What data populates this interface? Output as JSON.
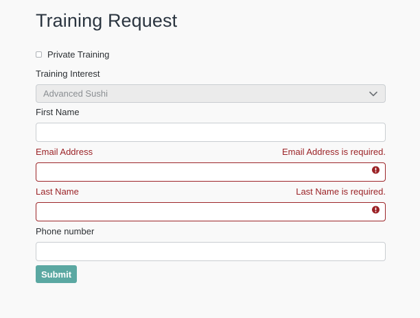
{
  "title": "Training Request",
  "private_training": {
    "label": "Private Training",
    "checked": false
  },
  "training_interest": {
    "label": "Training Interest",
    "selected": "Advanced Sushi"
  },
  "first_name": {
    "label": "First Name",
    "value": ""
  },
  "email": {
    "label": "Email Address",
    "error": "Email Address is required.",
    "value": ""
  },
  "last_name": {
    "label": "Last Name",
    "error": "Last Name is required.",
    "value": ""
  },
  "phone": {
    "label": "Phone number",
    "value": ""
  },
  "submit_label": "Submit",
  "colors": {
    "background": "#f9f9f9",
    "error": "#9b2226",
    "accent": "#5ba8a2",
    "select_bg": "#ebebeb"
  }
}
